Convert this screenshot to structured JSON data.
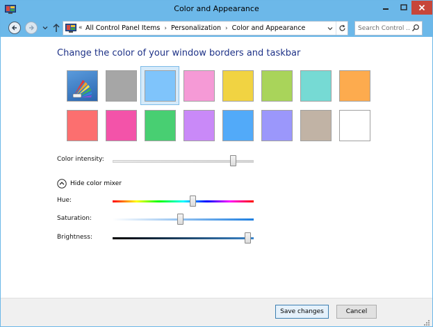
{
  "window": {
    "title": "Color and Appearance",
    "controls": [
      "minimize-icon",
      "maximize-icon",
      "close-icon"
    ]
  },
  "address_bar": {
    "overflow_marker": "«",
    "breadcrumb": [
      "All Control Panel Items",
      "Personalization",
      "Color and Appearance"
    ],
    "search_placeholder": "Search Control ..."
  },
  "main": {
    "heading": "Change the color of your window borders and taskbar",
    "swatches_row1": [
      {
        "id": "automatic",
        "color": "#3f7fc3",
        "selected": false
      },
      {
        "id": "gray",
        "color": "#a6a6a6",
        "selected": false
      },
      {
        "id": "sky",
        "color": "#7fc4fb",
        "selected": true
      },
      {
        "id": "pink",
        "color": "#f59ad6",
        "selected": false
      },
      {
        "id": "yellow",
        "color": "#f1d342",
        "selected": false
      },
      {
        "id": "lime",
        "color": "#a9d45a",
        "selected": false
      },
      {
        "id": "teal",
        "color": "#76dad4",
        "selected": false
      },
      {
        "id": "orange",
        "color": "#fdab4e",
        "selected": false
      }
    ],
    "swatches_row2": [
      {
        "id": "red",
        "color": "#fc6f6f",
        "selected": false
      },
      {
        "id": "magenta",
        "color": "#f353a9",
        "selected": false
      },
      {
        "id": "green",
        "color": "#48cf72",
        "selected": false
      },
      {
        "id": "violet",
        "color": "#c989f8",
        "selected": false
      },
      {
        "id": "blue",
        "color": "#52aaf9",
        "selected": false
      },
      {
        "id": "periwinkle",
        "color": "#9b97fb",
        "selected": false
      },
      {
        "id": "taupe",
        "color": "#c1b3a5",
        "selected": false
      },
      {
        "id": "white",
        "color": "#ffffff",
        "selected": false
      }
    ],
    "color_intensity": {
      "label": "Color intensity:",
      "value": 0.87
    },
    "mixer_toggle_label": "Hide color mixer",
    "hue": {
      "label": "Hue:",
      "value": 0.57
    },
    "saturation": {
      "label": "Saturation:",
      "value": 0.48
    },
    "brightness": {
      "label": "Brightness:",
      "value": 0.98
    }
  },
  "footer": {
    "save_label": "Save changes",
    "cancel_label": "Cancel"
  }
}
